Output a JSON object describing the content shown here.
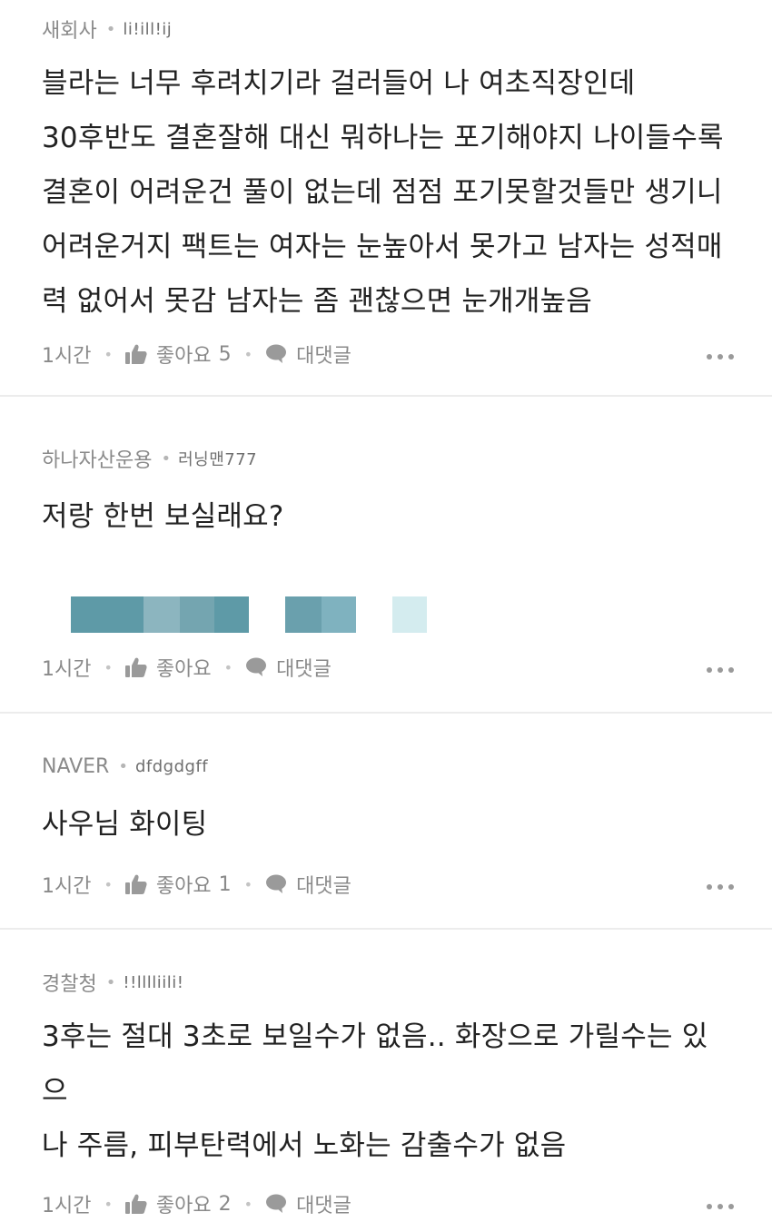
{
  "comments": [
    {
      "company": "새회사",
      "nickname": "li!ill!ij",
      "lines": [
        "블라는 너무 후려치기라 걸러들어 나 여초직장인데",
        "30후반도 결혼잘해 대신 뭐하나는 포기해야지 나이들수록",
        "결혼이 어려운건 풀이 없는데 점점 포기못할것들만 생기니",
        "어려운거지 팩트는 여자는 눈높아서 못가고 남자는 성적매",
        "력 없어서 못감 남자는 좀 괜찮으면 눈개개높음"
      ],
      "time": "1시간",
      "like_label": "좋아요",
      "like_count": "5",
      "reply_label": "대댓글"
    },
    {
      "company": "하나자산운용",
      "nickname": "러닝맨777",
      "lines": [
        "저랑 한번 보실래요?"
      ],
      "time": "1시간",
      "like_label": "좋아요",
      "like_count": "",
      "reply_label": "대댓글"
    },
    {
      "company": "NAVER",
      "nickname": "dfdgdgff",
      "lines": [
        "사우님 화이팅"
      ],
      "time": "1시간",
      "like_label": "좋아요",
      "like_count": "1",
      "reply_label": "대댓글"
    },
    {
      "company": "경찰청",
      "nickname": "!!lllliili!",
      "lines": [
        "3후는 절대 3초로 보일수가 없음.. 화장으로 가릴수는 있으",
        "나 주름, 피부탄력에서 노화는 감출수가 없음"
      ],
      "time": "1시간",
      "like_label": "좋아요",
      "like_count": "2",
      "reply_label": "대댓글"
    }
  ],
  "colors": {
    "text": "#222222",
    "meta": "#8a8a8a",
    "divider": "#ececec",
    "blur_blocks": [
      "#5e9aa7",
      "#8cb5bf",
      "#74a5b0",
      "#5e9aa7",
      "#ffffff",
      "#6aa0ad",
      "#7fb2bf",
      "#ffffff",
      "#d4ecef"
    ]
  },
  "icons": {
    "like": "thumbs-up-icon",
    "reply": "speech-bubble-icon",
    "more": "more-horizontal-icon"
  }
}
